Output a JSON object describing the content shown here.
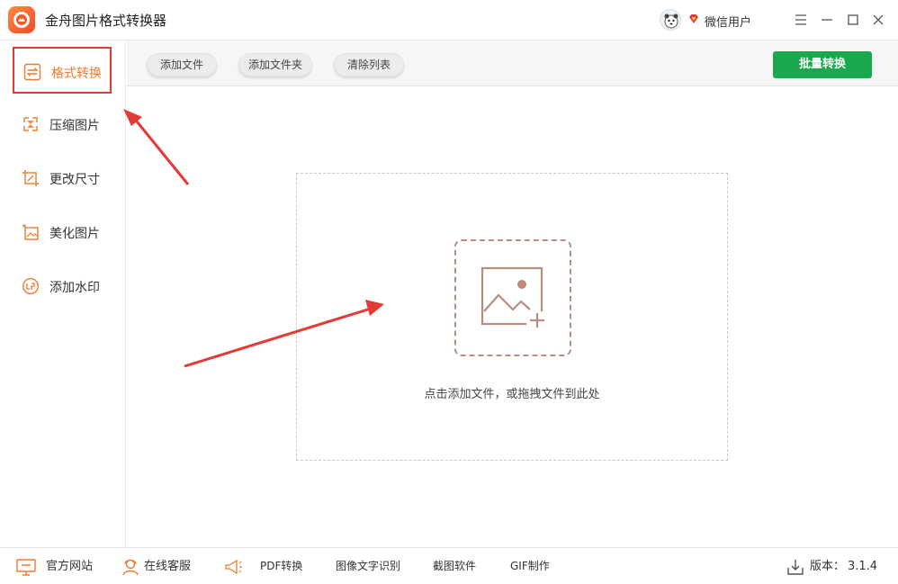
{
  "app": {
    "title": "金舟图片格式转换器"
  },
  "user": {
    "name": "微信用户"
  },
  "sidebar": {
    "items": [
      {
        "label": "格式转换",
        "active": true,
        "icon": "swap-icon"
      },
      {
        "label": "压缩图片",
        "active": false,
        "icon": "compress-icon"
      },
      {
        "label": "更改尺寸",
        "active": false,
        "icon": "resize-icon"
      },
      {
        "label": "美化图片",
        "active": false,
        "icon": "beautify-icon"
      },
      {
        "label": "添加水印",
        "active": false,
        "icon": "watermark-icon"
      }
    ]
  },
  "toolbar": {
    "add_file": "添加文件",
    "add_folder": "添加文件夹",
    "clear_list": "清除列表",
    "batch_convert": "批量转换"
  },
  "dropzone": {
    "hint": "点击添加文件，或拖拽文件到此处"
  },
  "footer": {
    "website": "官方网站",
    "support": "在线客服",
    "pdf": "PDF转换",
    "ocr": "图像文字识别",
    "screenshot": "截图软件",
    "gif": "GIF制作",
    "version_label": "版本：",
    "version": "3.1.4"
  },
  "colors": {
    "accent": "#f07a2e",
    "primary_button": "#1aa84f",
    "highlight_box": "#e53935"
  }
}
